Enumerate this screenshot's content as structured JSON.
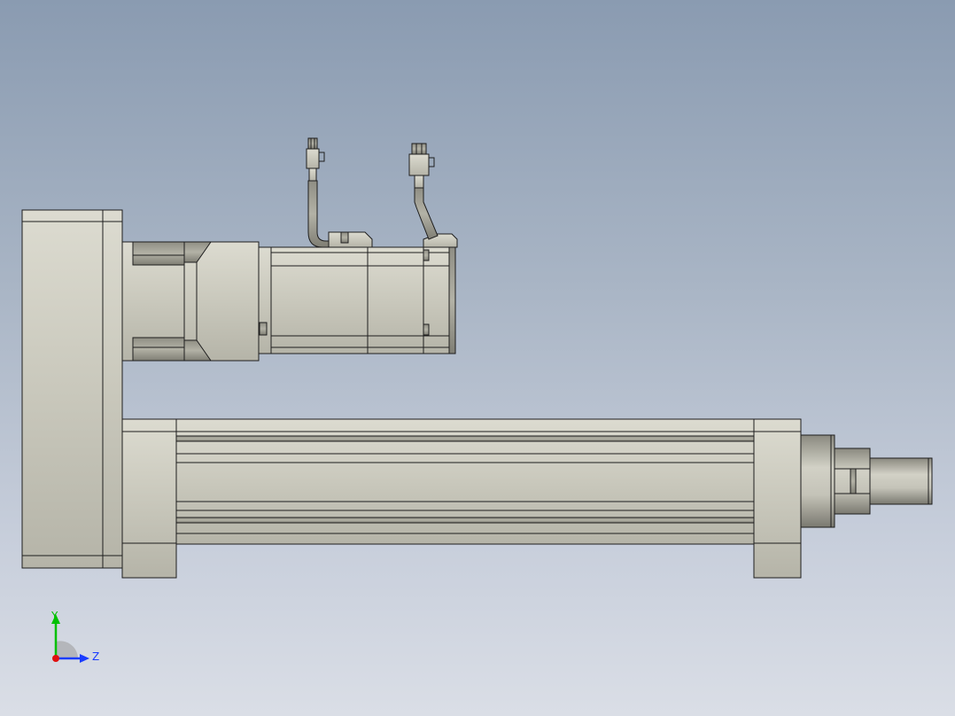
{
  "view": {
    "background_top": "#8a9bb1",
    "background_bottom": "#dadee6",
    "part_fill": "#c9c8bc",
    "part_fill_dark": "#a9a89c",
    "part_edge": "#1e1e1e"
  },
  "triad": {
    "y_label": "Y",
    "z_label": "Z",
    "y_color": "#00c000",
    "z_color": "#1a3cff",
    "x_color": "#e01010"
  }
}
